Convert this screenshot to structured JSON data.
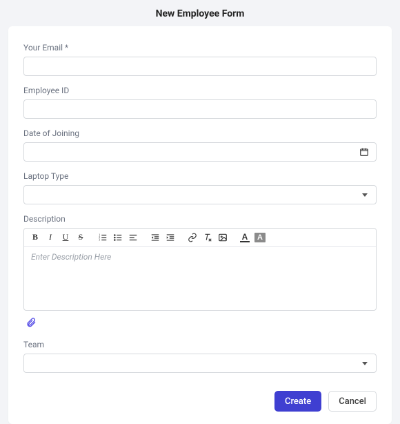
{
  "title": "New Employee Form",
  "fields": {
    "email": {
      "label": "Your Email *",
      "value": ""
    },
    "employeeId": {
      "label": "Employee ID",
      "value": ""
    },
    "doj": {
      "label": "Date of Joining",
      "value": ""
    },
    "laptop": {
      "label": "Laptop Type",
      "value": ""
    },
    "description": {
      "label": "Description",
      "placeholder": "Enter Description Here"
    },
    "team": {
      "label": "Team",
      "value": ""
    }
  },
  "toolbar": {
    "bold": "B",
    "italic": "I",
    "underline": "U",
    "strike": "S",
    "fontA": "A",
    "highlightA": "A"
  },
  "buttons": {
    "create": "Create",
    "cancel": "Cancel"
  }
}
